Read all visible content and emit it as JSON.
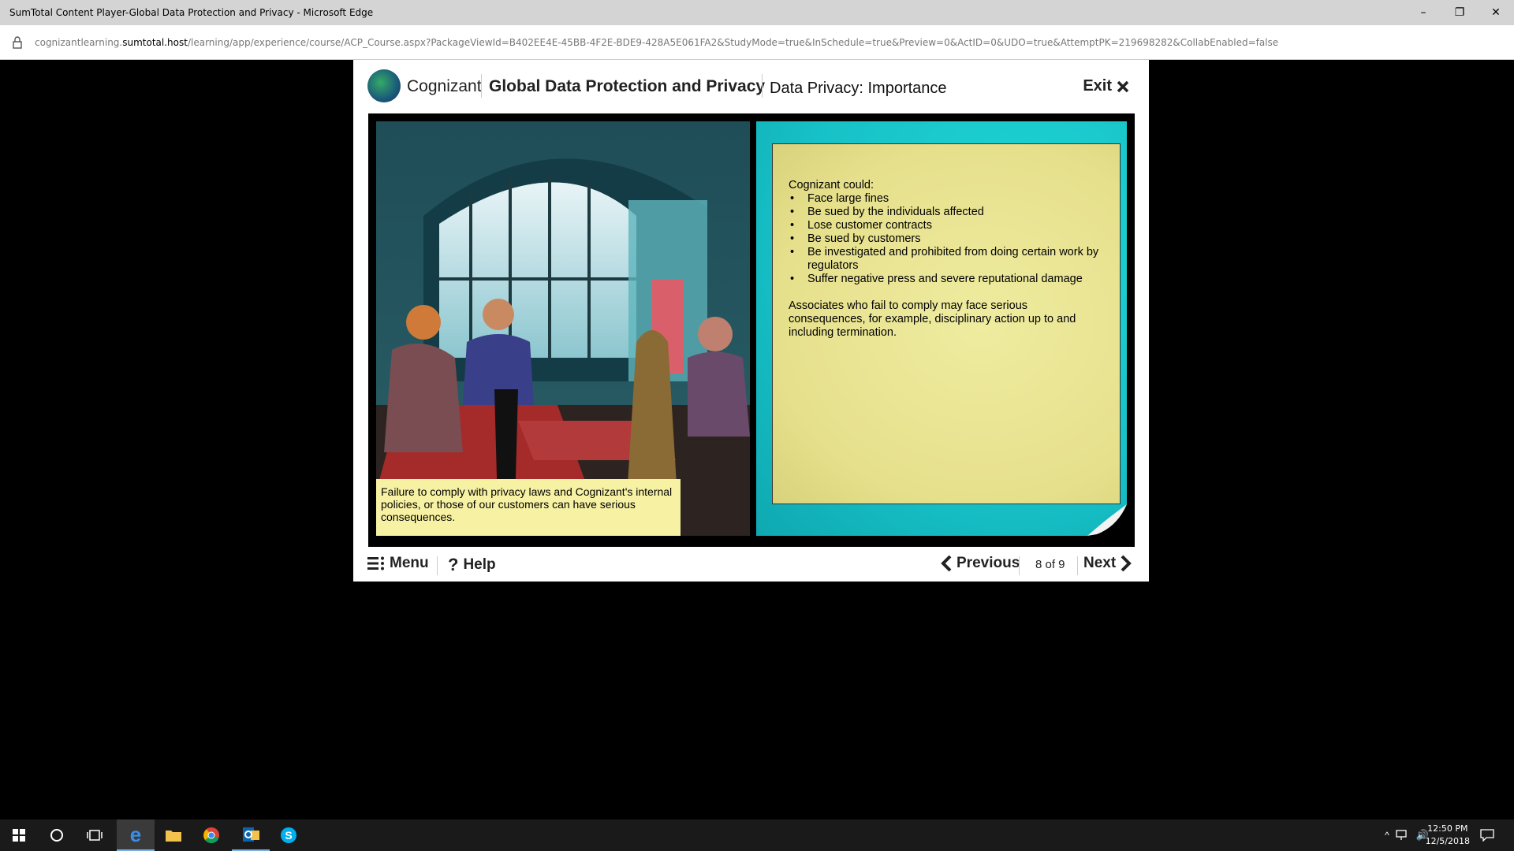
{
  "window": {
    "title": "SumTotal Content Player-Global Data Protection and Privacy - Microsoft Edge",
    "minimize": "–",
    "restore": "❐",
    "close": "✕"
  },
  "address": {
    "url_prefix": "cognizantlearning.",
    "url_host": "sumtotal.host",
    "url_path": "/learning/app/experience/course/ACP_Course.aspx?PackageViewId=B402EE4E-45BB-4F2E-BDE9-428A5E061FA2&StudyMode=true&InSchedule=true&Preview=0&ActID=0&UDO=true&AttemptPK=219698282&CollabEnabled=false"
  },
  "header": {
    "brand": "Cognizant",
    "course_title": "Global Data Protection and Privacy",
    "page_title": "Data Privacy: Importance",
    "exit_label": "Exit"
  },
  "slide": {
    "caption": "Failure to comply with privacy laws and Cognizant's internal policies, or those of our customers can have serious consequences.",
    "intro": "Cognizant could:",
    "bullets": [
      "Face large fines",
      "Be sued by the individuals affected",
      "Lose customer contracts",
      "Be sued by customers",
      "Be investigated and prohibited from doing certain work by regulators",
      "Suffer negative press and severe reputational damage"
    ],
    "paragraph": "Associates who fail to comply may face serious consequences, for example, disciplinary action up to and including termination."
  },
  "footer": {
    "menu_label": "Menu",
    "help_label": "Help",
    "previous_label": "Previous",
    "counter": "8 of 9",
    "next_label": "Next"
  },
  "taskbar": {
    "time": "12:50 PM",
    "date": "12/5/2018"
  },
  "colors": {
    "caption_bg": "#f7f2a3",
    "note_bg": "#e6e08c",
    "panel_teal": "#17c1c7"
  }
}
